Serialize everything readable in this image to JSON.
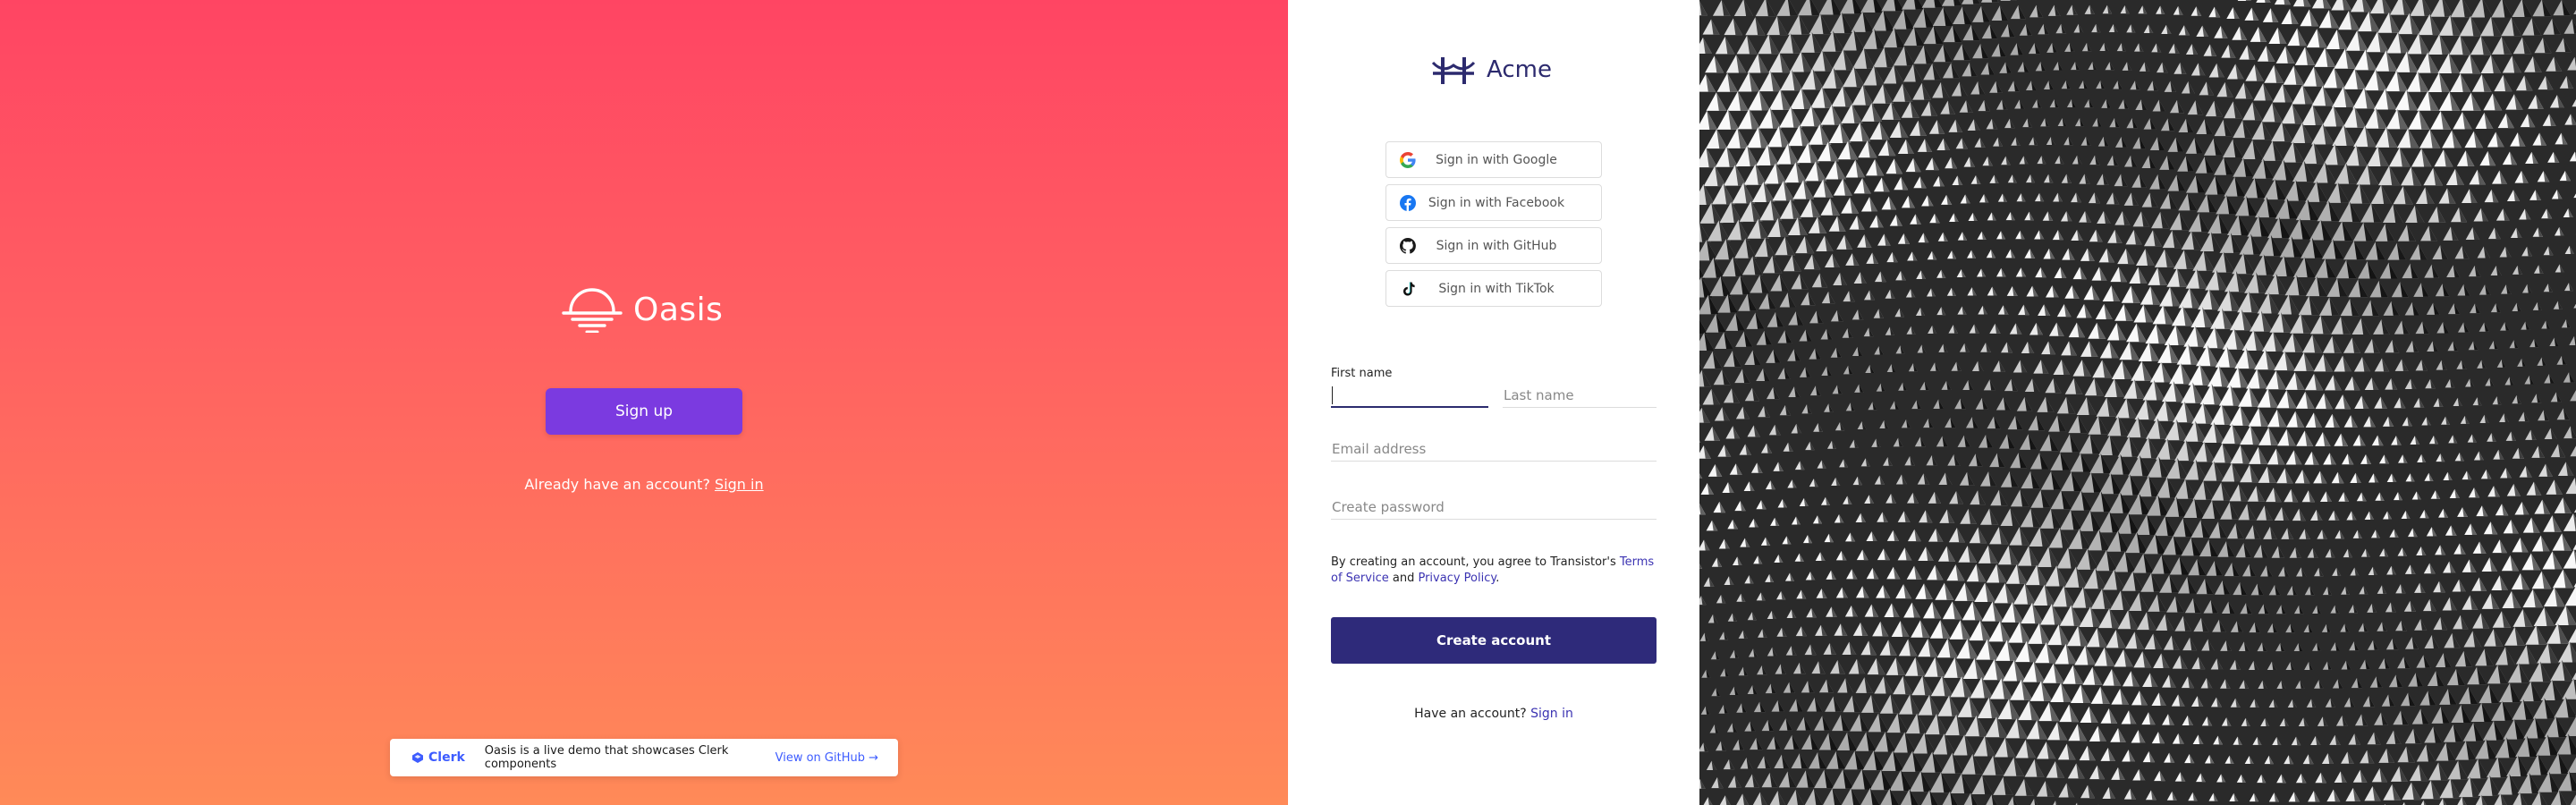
{
  "oasis": {
    "brand_name": "Oasis",
    "signup_label": "Sign up",
    "signin_prompt": "Already have an account?",
    "signin_link": "Sign in"
  },
  "banner": {
    "clerk_name": "Clerk",
    "text": "Oasis is a live demo that showcases Clerk components",
    "github_link": "View on GitHub →"
  },
  "acme": {
    "brand_name": "Acme",
    "social_buttons": [
      {
        "label": "Sign in with Google",
        "icon": "google-icon"
      },
      {
        "label": "Sign in with Facebook",
        "icon": "facebook-icon"
      },
      {
        "label": "Sign in with GitHub",
        "icon": "github-icon"
      },
      {
        "label": "Sign in with TikTok",
        "icon": "tiktok-icon"
      }
    ],
    "first_name_label": "First name",
    "first_name_value": "",
    "last_name_placeholder": "Last name",
    "email_placeholder": "Email address",
    "password_placeholder": "Create password",
    "terms_prefix": "By creating an account, you agree to Transistor's",
    "terms_link": "Terms of Service",
    "terms_and": "and",
    "privacy_link": "Privacy Policy",
    "terms_suffix": ".",
    "create_account_label": "Create account",
    "have_account_prompt": "Have an account?",
    "signin_link": "Sign in"
  },
  "colors": {
    "oasis_gradient_top": "#ff4563",
    "oasis_gradient_bottom": "#ff8a58",
    "signup_button": "#7b3ae0",
    "acme_primary": "#2e2a7a",
    "acme_link": "#3b33b2",
    "clerk_brand": "#3d5cff"
  }
}
